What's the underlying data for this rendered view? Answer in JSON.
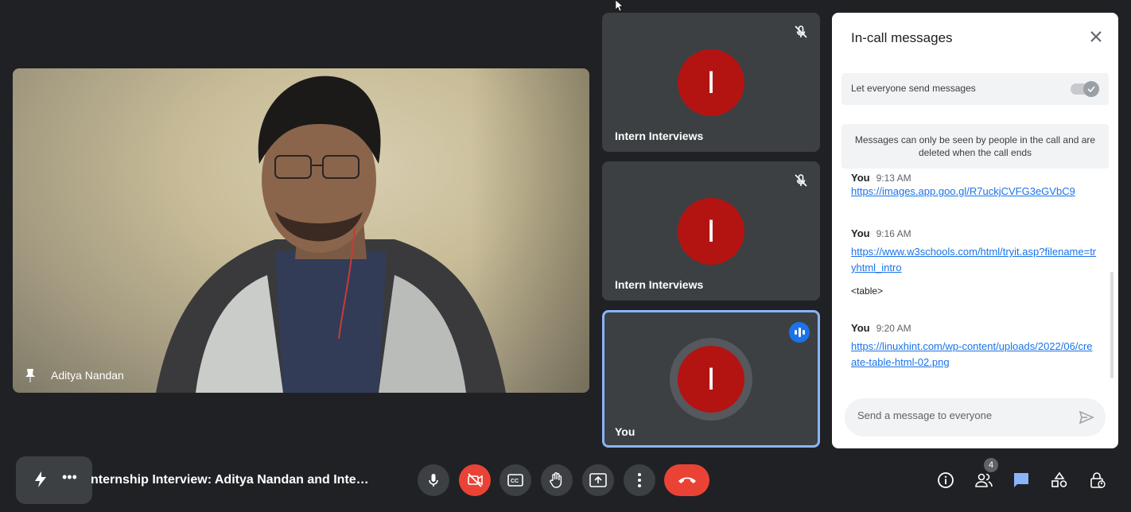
{
  "main": {
    "speaker_name": "Aditya Nandan"
  },
  "tiles": [
    {
      "name": "Intern Interviews",
      "initial": "I"
    },
    {
      "name": "Intern Interviews",
      "initial": "I"
    },
    {
      "name": "You",
      "initial": "I"
    }
  ],
  "chat": {
    "title": "In-call messages",
    "toggle_label": "Let everyone send messages",
    "toggle_on": true,
    "info": "Messages can only be seen by people in the call and are deleted when the call ends",
    "messages": [
      {
        "sender": "You",
        "time": "9:13 AM",
        "link": "https://images.app.goo.gl/R7uckjCVFG3eGVbC9"
      },
      {
        "sender": "You",
        "time": "9:16 AM",
        "link": "https://www.w3schools.com/html/tryit.asp?filename=tryhtml_intro",
        "text": "<table>"
      },
      {
        "sender": "You",
        "time": "9:20 AM",
        "link": "https://linuxhint.com/wp-content/uploads/2022/06/create-table-html-02.png"
      }
    ],
    "compose_placeholder": "Send a message to everyone"
  },
  "bottom": {
    "meeting_title": "nternship Interview: Aditya Nandan and Inter...",
    "participants_count": "4"
  },
  "colors": {
    "accent": "#1a73e8",
    "danger": "#ea4335",
    "avatar": "#b31412",
    "bg": "#202124"
  }
}
